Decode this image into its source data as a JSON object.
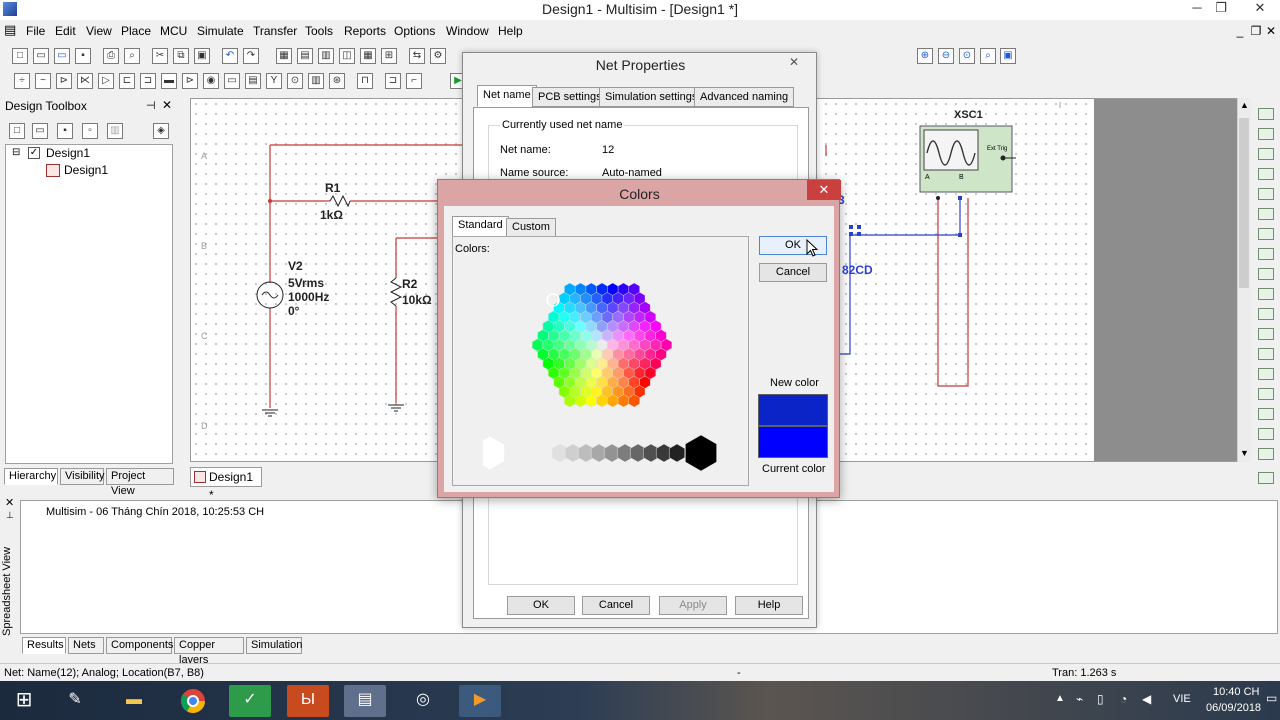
{
  "window": {
    "title": "Design1 - Multisim - [Design1 *]"
  },
  "menu": [
    "File",
    "Edit",
    "View",
    "Place",
    "MCU",
    "Simulate",
    "Transfer",
    "Tools",
    "Reports",
    "Options",
    "Window",
    "Help"
  ],
  "toolbox": {
    "title": "Design Toolbox",
    "tree_root": "Design1",
    "tree_child": "Design1",
    "tabs": [
      "Hierarchy",
      "Visibility",
      "Project View"
    ]
  },
  "doc_tab": "Design1 *",
  "schematic": {
    "r1_name": "R1",
    "r1_value": "1kΩ",
    "v2_name": "V2",
    "v2_rms": "5Vrms",
    "v2_freq": "1000Hz",
    "v2_phase": "0°",
    "r2_name": "R2",
    "r2_value": "10kΩ",
    "xsc1": "XSC1",
    "diode": "82CD",
    "net_3": "3",
    "ext_trig": "Ext Trig",
    "scope_a": "A",
    "scope_b": "B",
    "ruler_labels": [
      "A",
      "B",
      "C",
      "D"
    ]
  },
  "net_properties": {
    "title": "Net Properties",
    "tabs": [
      "Net name",
      "PCB settings",
      "Simulation settings",
      "Advanced naming"
    ],
    "section": "Currently used net name",
    "net_name_label": "Net name:",
    "net_name_value": "12",
    "source_label": "Name source:",
    "source_value": "Auto-named",
    "buttons": {
      "ok": "OK",
      "cancel": "Cancel",
      "apply": "Apply",
      "help": "Help"
    }
  },
  "colors_dialog": {
    "title": "Colors",
    "close": "✕",
    "tabs": [
      "Standard",
      "Custom"
    ],
    "colors_label": "Colors:",
    "ok": "OK",
    "cancel": "Cancel",
    "new_color_label": "New color",
    "current_color_label": "Current color",
    "new_color": "#0a24c8",
    "current_color": "#0000ff"
  },
  "spreadsheet": {
    "log": "Multisim  -  06 Tháng Chín 2018, 10:25:53 CH",
    "side_label": "Spreadsheet View",
    "tabs": [
      "Results",
      "Nets",
      "Components",
      "Copper layers",
      "Simulation"
    ]
  },
  "statusbar": {
    "left": "Net: Name(12); Analog; Location(B7, B8)",
    "mid": "-",
    "right": "Tran: 1.263 s"
  },
  "taskbar": {
    "lang": "VIE",
    "time": "10:40 CH",
    "date": "06/09/2018"
  }
}
